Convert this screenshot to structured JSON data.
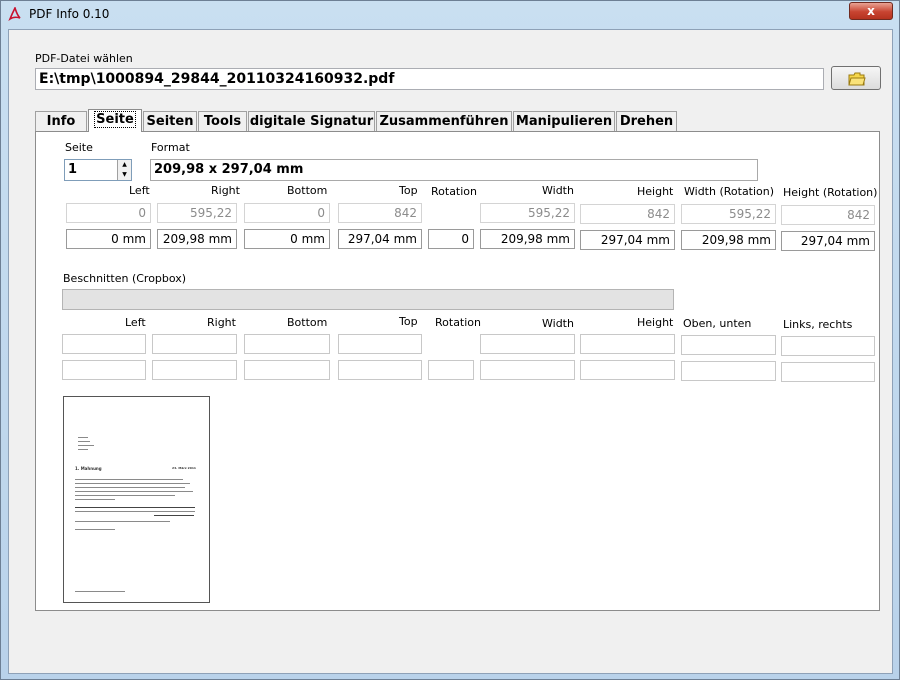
{
  "window": {
    "title": "PDF Info 0.10",
    "close": "x"
  },
  "file": {
    "label": "PDF-Datei wählen",
    "path": "E:\\tmp\\1000894_29844_20110324160932.pdf"
  },
  "tabs": [
    "Info",
    "Seite",
    "Seiten",
    "Tools",
    "digitale Signatur",
    "Zusammenführen",
    "Manipulieren",
    "Drehen"
  ],
  "active_tab": "Seite",
  "seite": {
    "page_label": "Seite",
    "page_value": "1",
    "format_label": "Format",
    "format_value": "209,98 x 297,04 mm",
    "headers": {
      "left": "Left",
      "right": "Right",
      "bottom": "Bottom",
      "top": "Top",
      "rotation": "Rotation",
      "width": "Width",
      "height": "Height",
      "width_rot": "Width (Rotation)",
      "height_rot": "Height (Rotation)"
    },
    "points": {
      "left": "0",
      "right": "595,22",
      "bottom": "0",
      "top": "842",
      "width": "595,22",
      "height": "842",
      "width_rot": "595,22",
      "height_rot": "842"
    },
    "mm": {
      "left": "0 mm",
      "right": "209,98 mm",
      "bottom": "0 mm",
      "top": "297,04 mm",
      "rotation": "0",
      "width": "209,98 mm",
      "height": "297,04 mm",
      "width_rot": "209,98 mm",
      "height_rot": "297,04 mm"
    },
    "crop_label": "Beschnitten (Cropbox)",
    "crop_headers": {
      "left": "Left",
      "right": "Right",
      "bottom": "Bottom",
      "top": "Top",
      "rotation": "Rotation",
      "width": "Width",
      "height": "Height",
      "oben_unten": "Oben, unten",
      "links_rechts": "Links, rechts"
    }
  },
  "thumbnail": {
    "heading": "1. Mahnung",
    "date": "24. März 2011",
    "icon": "pdf-page-thumbnail"
  },
  "icons": {
    "app": "pdf-icon",
    "folder": "folder-icon"
  }
}
